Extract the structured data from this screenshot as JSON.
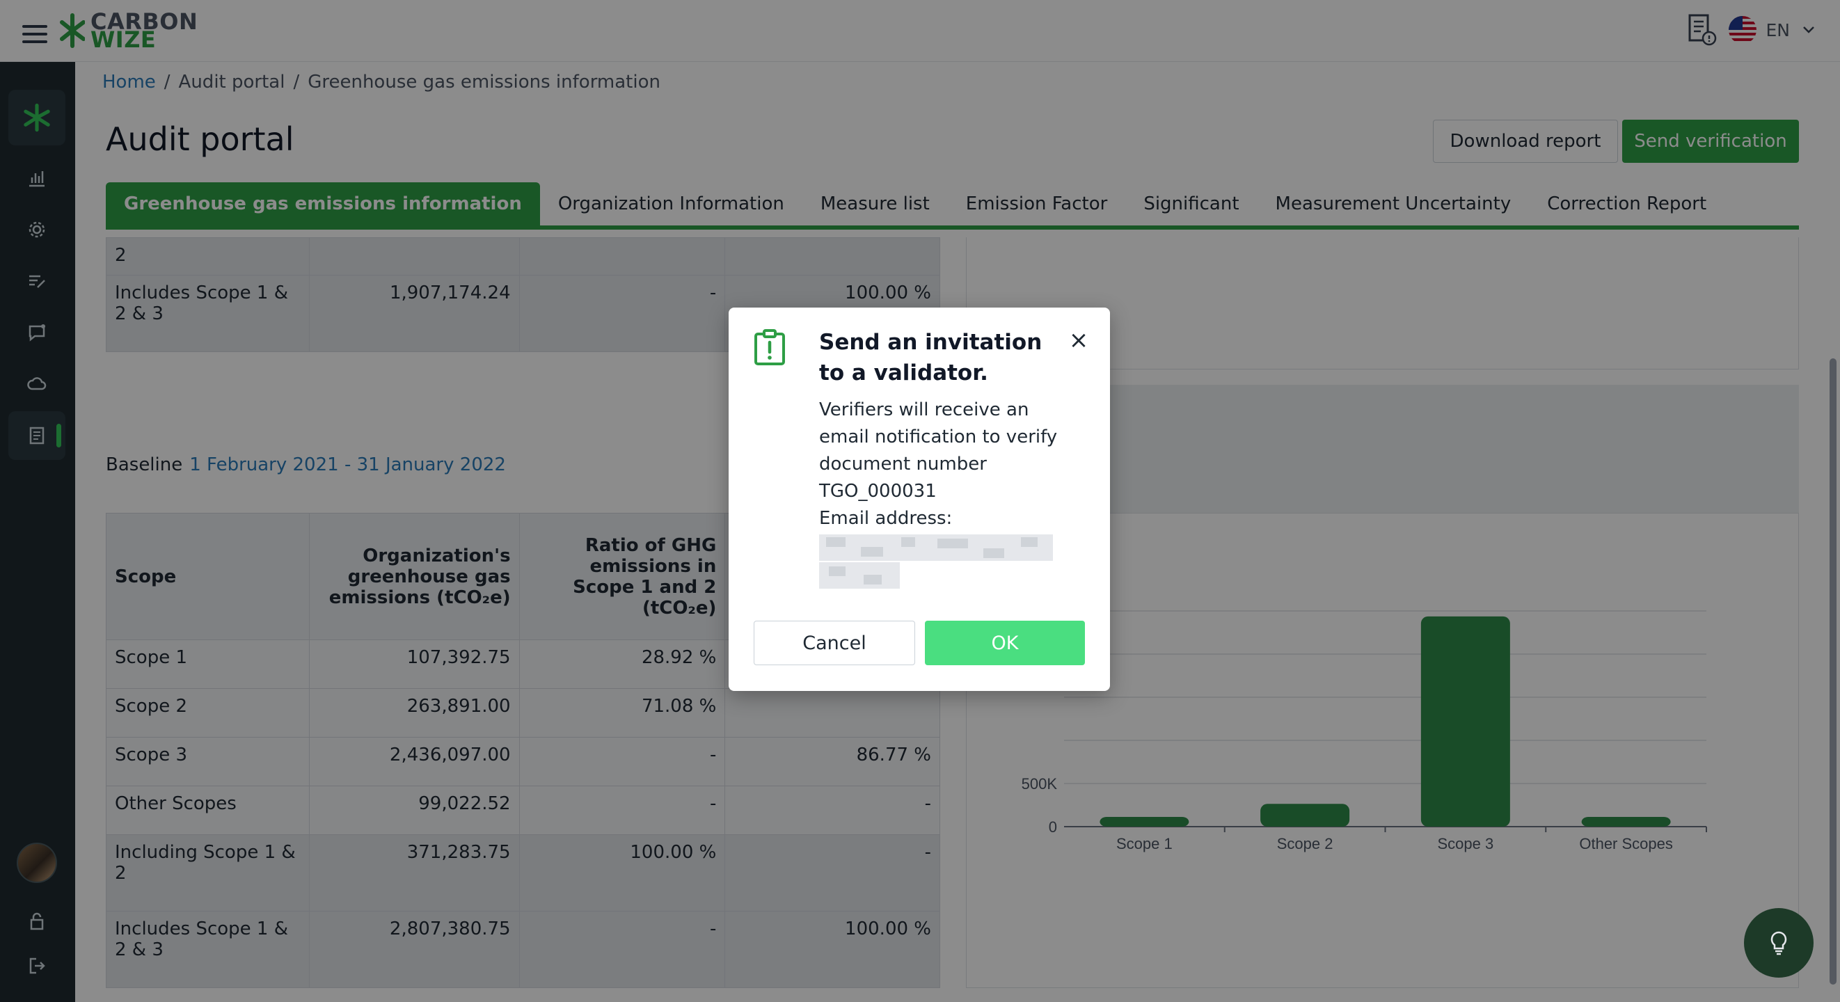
{
  "brand": {
    "line1": "CARBON",
    "line2": "WIZE",
    "green": "#2e9e45",
    "dark_sidebar": "#1f2a30"
  },
  "topbar": {
    "language": "EN",
    "icons": [
      "menu-icon",
      "document-info-icon",
      "us-flag-icon",
      "chevron-down-icon"
    ]
  },
  "sidebar": {
    "icons": [
      "dashboard-icon",
      "bar-chart-icon",
      "settings-icon",
      "edit-list-icon",
      "chat-icon",
      "cloud-icon",
      "report-icon",
      "unlock-icon",
      "logout-icon"
    ]
  },
  "breadcrumb": {
    "home": "Home",
    "sep": "/",
    "audit": "Audit portal",
    "current": "Greenhouse gas emissions information"
  },
  "page": {
    "title": "Audit portal",
    "download_label": "Download report",
    "send_label": "Send verification"
  },
  "tabs": [
    "Greenhouse gas emissions information",
    "Organization Information",
    "Measure list",
    "Emission Factor",
    "Significant",
    "Measurement Uncertainty",
    "Correction Report"
  ],
  "table_top": {
    "rows": [
      {
        "scope": "2",
        "emissions": "",
        "ratio": "",
        "share": ""
      },
      {
        "scope": "Includes Scope 1 & 2 & 3",
        "emissions": "1,907,174.24",
        "ratio": "-",
        "share": "100.00 %"
      }
    ]
  },
  "baseline": {
    "label": "Baseline",
    "range": "1 February 2021 - 31 January 2022"
  },
  "table_baseline": {
    "headers": [
      "Scope",
      "Organization's greenhouse gas emissions (tCO₂e)",
      "Ratio of GHG emissions in Scope 1 and 2 (tCO₂e)",
      ""
    ],
    "rows": [
      {
        "scope": "Scope 1",
        "emissions": "107,392.75",
        "ratio": "28.92 %",
        "share": ""
      },
      {
        "scope": "Scope 2",
        "emissions": "263,891.00",
        "ratio": "71.08 %",
        "share": ""
      },
      {
        "scope": "Scope 3",
        "emissions": "2,436,097.00",
        "ratio": "-",
        "share": "86.77 %"
      },
      {
        "scope": "Other Scopes",
        "emissions": "99,022.52",
        "ratio": "-",
        "share": "-"
      },
      {
        "scope": "Including Scope 1 & 2",
        "emissions": "371,283.75",
        "ratio": "100.00 %",
        "share": "-"
      },
      {
        "scope": "Includes Scope 1 & 2 & 3",
        "emissions": "2,807,380.75",
        "ratio": "-",
        "share": "100.00 %"
      }
    ]
  },
  "chart_data": {
    "type": "bar",
    "categories": [
      "Scope 1",
      "Scope 2",
      "Scope 3",
      "Other Scopes"
    ],
    "values": [
      107392.75,
      263891.0,
      2436097.0,
      99022.52
    ],
    "y_tick_labels": [
      "0",
      "500K"
    ],
    "ylim": [
      0,
      2500000
    ],
    "bar_color": "#2e8b4a",
    "title": "",
    "xlabel": "",
    "ylabel": ""
  },
  "modal": {
    "title": "Send an invitation to a validator.",
    "body_line1": "Verifiers will receive an email notification to verify document number",
    "doc_number": "TGO_000031",
    "email_label": "Email address:",
    "cancel_label": "Cancel",
    "ok_label": "OK",
    "close_symbol": "×",
    "ok_color": "#4ade80"
  }
}
